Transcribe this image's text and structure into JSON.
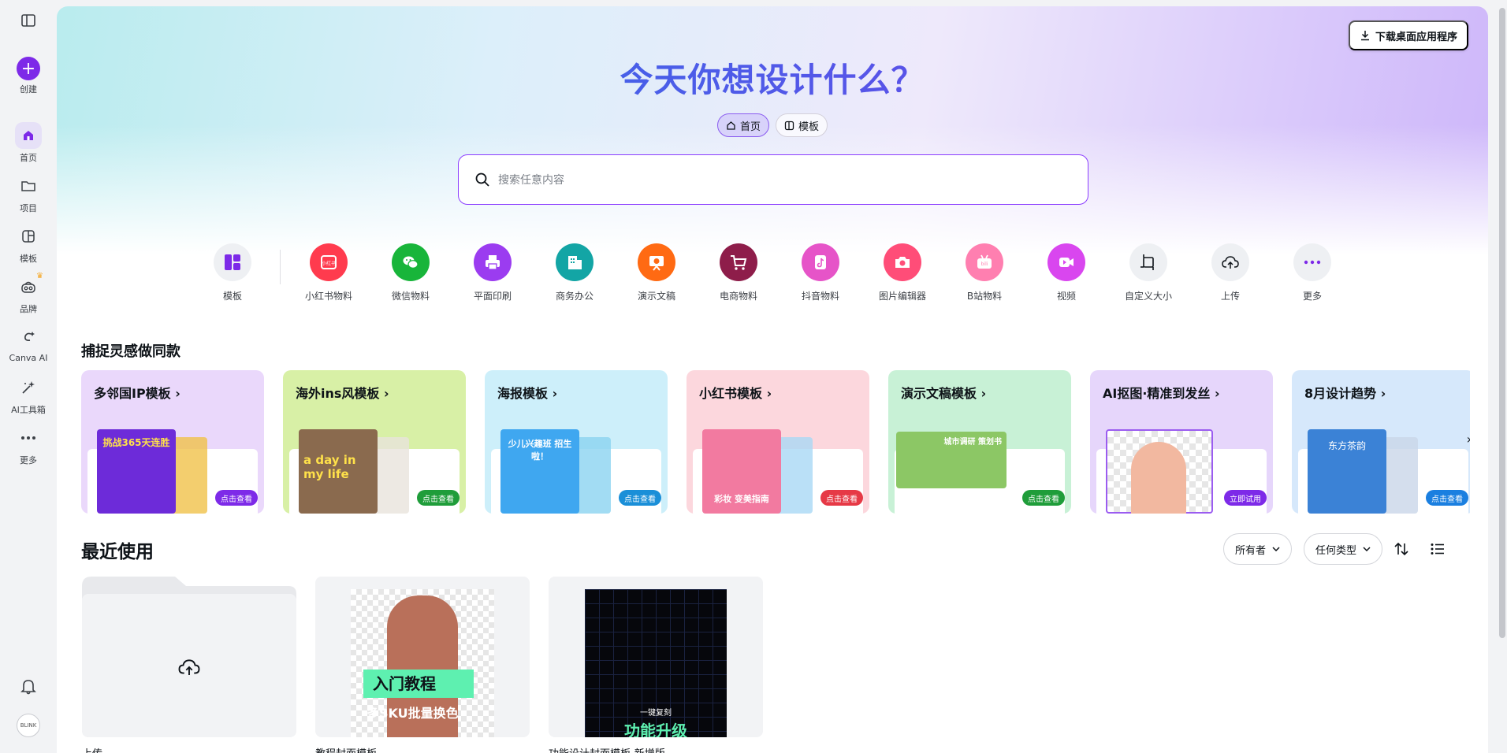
{
  "sidebar": {
    "items": [
      {
        "label": "创建"
      },
      {
        "label": "首页"
      },
      {
        "label": "项目"
      },
      {
        "label": "模板"
      },
      {
        "label": "品牌"
      },
      {
        "label": "Canva AI"
      },
      {
        "label": "AI工具箱"
      },
      {
        "label": "更多"
      }
    ],
    "avatar_text": "BLINK"
  },
  "header": {
    "download_label": "下载桌面应用程序",
    "title": "今天你想设计什么？",
    "tabs": [
      {
        "label": "首页"
      },
      {
        "label": "模板"
      }
    ]
  },
  "search": {
    "placeholder": "搜索任意内容",
    "value": ""
  },
  "categories": [
    {
      "label": "模板",
      "color": "#eef0f3",
      "icon_color": "#7d2ae8"
    },
    {
      "label": "小红书物料",
      "color": "#ff3b4e"
    },
    {
      "label": "微信物料",
      "color": "#18b53a"
    },
    {
      "label": "平面印刷",
      "color": "#9b3cf0"
    },
    {
      "label": "商务办公",
      "color": "#13a5a5"
    },
    {
      "label": "演示文稿",
      "color": "#ff6a13"
    },
    {
      "label": "电商物料",
      "color": "#8e1d4a"
    },
    {
      "label": "抖音物料",
      "color": "#e654c8"
    },
    {
      "label": "图片编辑器",
      "color": "#ff4d78"
    },
    {
      "label": "B站物料",
      "color": "#ff7fb0"
    },
    {
      "label": "视频",
      "color": "#d946ef"
    },
    {
      "label": "自定义大小",
      "color": "#eef0f3"
    },
    {
      "label": "上传",
      "color": "#eef0f3"
    },
    {
      "label": "更多",
      "color": "#eef0f3"
    }
  ],
  "inspiration": {
    "title": "捕捉灵感做同款",
    "cards": [
      {
        "title": "多邻国IP模板",
        "button": "点击查看",
        "bg": "#ead8fb",
        "btn_color": "#7d2ae8",
        "thumb_text": "挑战365天连胜",
        "thumb_color": "#6d2bd9"
      },
      {
        "title": "海外ins风模板",
        "button": "点击查看",
        "bg": "#d8f0a6",
        "btn_color": "#1f9d3a",
        "thumb_text": "a day in my life",
        "thumb_color": "#8a6a4e"
      },
      {
        "title": "海报模板",
        "button": "点击查看",
        "bg": "#cdeffa",
        "btn_color": "#1a8fd8",
        "thumb_text": "少儿兴趣班 招生啦！",
        "thumb_color": "#3fa7f0"
      },
      {
        "title": "小红书模板",
        "button": "点击查看",
        "bg": "#fcd7dd",
        "btn_color": "#e63946",
        "thumb_text": "彩妆 变美指南",
        "thumb_color": "#f27aa0"
      },
      {
        "title": "演示文稿模板",
        "button": "点击查看",
        "bg": "#c8f1d6",
        "btn_color": "#1f9d3a",
        "thumb_text": "城市调研 策划书",
        "thumb_color": "#8cc765"
      },
      {
        "title": "AI抠图·精准到发丝",
        "button": "立即试用",
        "bg": "#e6d6fb",
        "btn_color": "#7d2ae8",
        "thumb_text": "",
        "thumb_color": "#c9a7f0"
      },
      {
        "title": "8月设计趋势",
        "button": "点击查看",
        "bg": "#d6e8fb",
        "btn_color": "#1a7fe0",
        "thumb_text": "东方茶韵",
        "thumb_color": "#3b82d6"
      }
    ]
  },
  "recent": {
    "title": "最近使用",
    "filters": [
      {
        "label": "所有者"
      },
      {
        "label": "任何类型"
      }
    ],
    "items": [
      {
        "label": "上传",
        "type": "upload"
      },
      {
        "label": "教程封面模板",
        "thumb_title": "入门教程",
        "thumb_sub": "多SKU批量换色"
      },
      {
        "label": "功能设计封面模板-新增版",
        "thumb_title": "功能升级",
        "thumb_sub": "一键复刻"
      }
    ]
  }
}
